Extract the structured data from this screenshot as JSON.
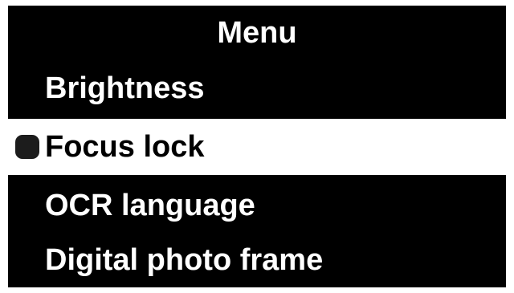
{
  "menu": {
    "title": "Menu",
    "items": [
      {
        "label": "Brightness",
        "selected": false
      },
      {
        "label": "Focus lock",
        "selected": true
      },
      {
        "label": "OCR language",
        "selected": false
      },
      {
        "label": "Digital photo frame",
        "selected": false
      }
    ]
  },
  "colors": {
    "background": "#000000",
    "text": "#ffffff",
    "selected_background": "#ffffff",
    "selected_text": "#000000"
  },
  "icons": {
    "selection_marker": "bullet-icon"
  }
}
